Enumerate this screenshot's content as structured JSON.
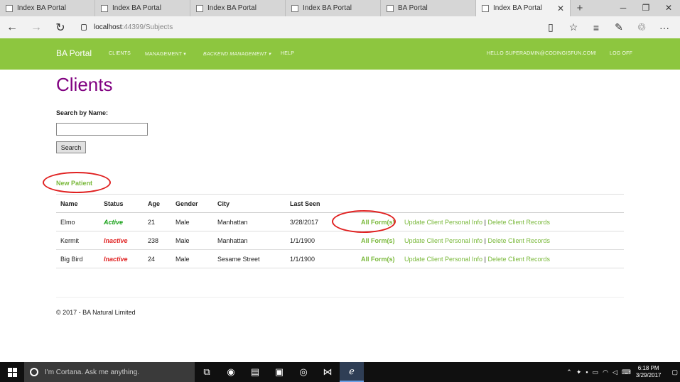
{
  "browser": {
    "tabs": [
      {
        "title": "Index BA Portal"
      },
      {
        "title": "Index BA Portal"
      },
      {
        "title": "Index BA Portal"
      },
      {
        "title": "Index BA Portal"
      },
      {
        "title": "BA Portal"
      },
      {
        "title": "Index BA Portal"
      }
    ],
    "url_host": "localhost",
    "url_rest": ":44399/Subjects"
  },
  "navbar": {
    "brand": "BA Portal",
    "clients": "CLIENTS",
    "management": "MANAGEMENT",
    "backend": "BACKEND MANAGEMENT",
    "help": "HELP",
    "hello": "HELLO SUPERADMIN@CODINGISFUN.COM!",
    "logoff": "LOG OFF"
  },
  "page": {
    "title": "Clients",
    "search_label": "Search by Name:",
    "search_value": "",
    "search_button": "Search",
    "new_patient": "New Patient"
  },
  "table": {
    "headers": [
      "Name",
      "Status",
      "Age",
      "Gender",
      "City",
      "Last Seen"
    ],
    "rows": [
      {
        "name": "Elmo",
        "status": "Active",
        "age": "21",
        "gender": "Male",
        "city": "Manhattan",
        "last_seen": "3/28/2017",
        "forms": "All Form(s)",
        "update": "Update Client Personal Info",
        "sep": "|",
        "delete": "Delete Client Records"
      },
      {
        "name": "Kermit",
        "status": "Inactive",
        "age": "238",
        "gender": "Male",
        "city": "Manhattan",
        "last_seen": "1/1/1900",
        "forms": "All Form(s)",
        "update": "Update Client Personal Info",
        "sep": "|",
        "delete": "Delete Client Records"
      },
      {
        "name": "Big Bird",
        "status": "Inactive",
        "age": "24",
        "gender": "Male",
        "city": "Sesame Street",
        "last_seen": "1/1/1900",
        "forms": "All Form(s)",
        "update": "Update Client Personal Info",
        "sep": "|",
        "delete": "Delete Client Records"
      }
    ]
  },
  "footer": {
    "text": "© 2017 - BA Natural Limited"
  },
  "taskbar": {
    "cortana": "I'm Cortana. Ask me anything.",
    "time": "6:18 PM",
    "date": "3/29/2017"
  },
  "colors": {
    "navbar": "#8dc63f",
    "title": "#800080",
    "link": "#7ab93b",
    "active": "#16a016",
    "inactive": "#e02020",
    "annotation": "#e02020"
  }
}
